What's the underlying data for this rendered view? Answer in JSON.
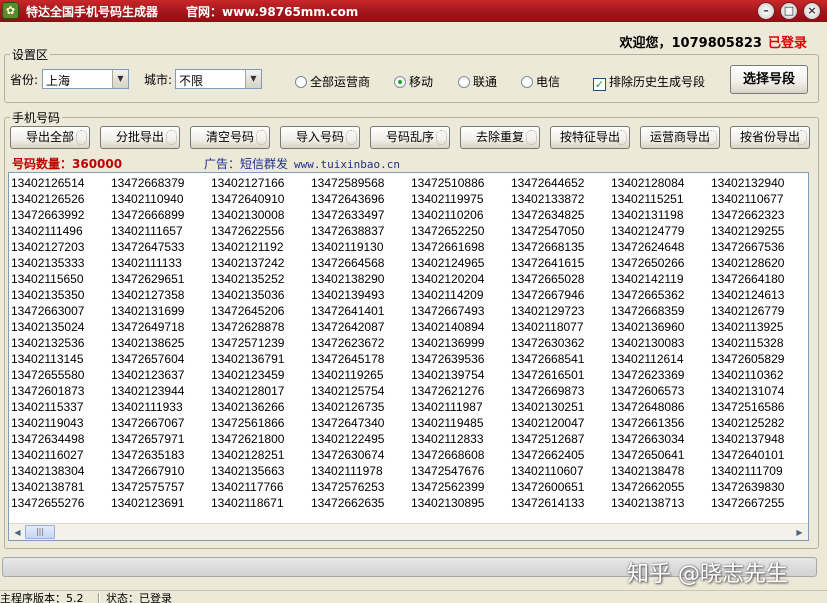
{
  "window": {
    "title": "特达全国手机号码生成器",
    "website": "官网：www.98765mm.com",
    "buttons": {
      "minimize": "–",
      "maximize": "□",
      "close": "×"
    }
  },
  "welcome": {
    "text": "欢迎您，1079805823",
    "status": "已登录"
  },
  "settings": {
    "group_title": "设置区",
    "province_label": "省份:",
    "province_value": "上海",
    "city_label": "城市:",
    "city_value": "不限",
    "carriers": [
      {
        "label": "全部运营商",
        "selected": false
      },
      {
        "label": "移动",
        "selected": true
      },
      {
        "label": "联通",
        "selected": false
      },
      {
        "label": "电信",
        "selected": false
      }
    ],
    "exclude_history_label": "排除历史生成号段",
    "exclude_history_checked": true,
    "select_segment_button": "选择号段"
  },
  "numbers": {
    "group_title": "手机号码",
    "toolbar": [
      "导出全部",
      "分批导出",
      "清空号码",
      "导入号码",
      "号码乱序",
      "去除重复",
      "按特征导出",
      "运营商导出",
      "按省份导出"
    ],
    "count_text": "号码数量：360000",
    "ad_label": "广告：短信群发",
    "ad_url": "www.tuixinbao.cn",
    "rows": [
      [
        "13402126514",
        "13472668379",
        "13402127166",
        "13472589568",
        "13472510886",
        "13472644652",
        "13402128084",
        "13402132940"
      ],
      [
        "13402126526",
        "13402110940",
        "13472640910",
        "13472643696",
        "13402119975",
        "13402133872",
        "13402115251",
        "13402110677"
      ],
      [
        "13472663992",
        "13472666899",
        "13402130008",
        "13472633497",
        "13402110206",
        "13472634825",
        "13402131198",
        "13472662323"
      ],
      [
        "13402111496",
        "13402111657",
        "13472622556",
        "13472638837",
        "13472652250",
        "13472547050",
        "13402124779",
        "13402129255"
      ],
      [
        "13402127203",
        "13472647533",
        "13402121192",
        "13402119130",
        "13472661698",
        "13472668135",
        "13472624648",
        "13472667536"
      ],
      [
        "13402135333",
        "13402111133",
        "13402137242",
        "13472664568",
        "13402124965",
        "13472641615",
        "13472650266",
        "13402128620"
      ],
      [
        "13402115650",
        "13472629651",
        "13402135252",
        "13402138290",
        "13402120204",
        "13472665028",
        "13402142119",
        "13472664180"
      ],
      [
        "13402135350",
        "13402127358",
        "13402135036",
        "13402139493",
        "13402114209",
        "13472667946",
        "13472665362",
        "13402124613"
      ],
      [
        "13472663007",
        "13402131699",
        "13472645206",
        "13472641401",
        "13472667493",
        "13402129723",
        "13472668359",
        "13402126779"
      ],
      [
        "13402135024",
        "13472649718",
        "13472628878",
        "13472642087",
        "13402140894",
        "13402118077",
        "13402136960",
        "13402113925"
      ],
      [
        "13402132536",
        "13402138625",
        "13472571239",
        "13472623672",
        "13402136999",
        "13472630362",
        "13402130083",
        "13402115328"
      ],
      [
        "13402113145",
        "13472657604",
        "13402136791",
        "13472645178",
        "13472639536",
        "13472668541",
        "13402112614",
        "13472605829"
      ],
      [
        "13472655580",
        "13402123637",
        "13402123459",
        "13402119265",
        "13402139754",
        "13472616501",
        "13472623369",
        "13402110362"
      ],
      [
        "13472601873",
        "13402123944",
        "13402128017",
        "13402125754",
        "13472621276",
        "13472669873",
        "13472606573",
        "13402131074"
      ],
      [
        "13402115337",
        "13402111933",
        "13402136266",
        "13402126735",
        "13402111987",
        "13402130251",
        "13472648086",
        "13472516586"
      ],
      [
        "13402119043",
        "13472667067",
        "13472561866",
        "13472647340",
        "13402119485",
        "13402120047",
        "13472661356",
        "13402125282"
      ],
      [
        "13472634498",
        "13472657971",
        "13472621800",
        "13402122495",
        "13402112833",
        "13472512687",
        "13472663034",
        "13402137948"
      ],
      [
        "13402116027",
        "13472635183",
        "13402128251",
        "13472630674",
        "13472668608",
        "13472662405",
        "13472650641",
        "13472640101"
      ],
      [
        "13402138304",
        "13472667910",
        "13402135663",
        "13402111978",
        "13472547676",
        "13402110607",
        "13402138478",
        "13402111709"
      ],
      [
        "13402138781",
        "13472575757",
        "13402117766",
        "13472576253",
        "13472562399",
        "13472600651",
        "13472662055",
        "13472639830"
      ],
      [
        "13472655276",
        "13402123691",
        "13402118671",
        "13472662635",
        "13402130895",
        "13472614133",
        "13402138713",
        "13472667255"
      ]
    ]
  },
  "watermark": "知乎 @晓志先生",
  "statusbar": {
    "version": "主程序版本：5.2",
    "status": "状态：已登录"
  },
  "icons": {
    "app": "app-logo-icon",
    "dropdown": "chevron-down-icon"
  }
}
